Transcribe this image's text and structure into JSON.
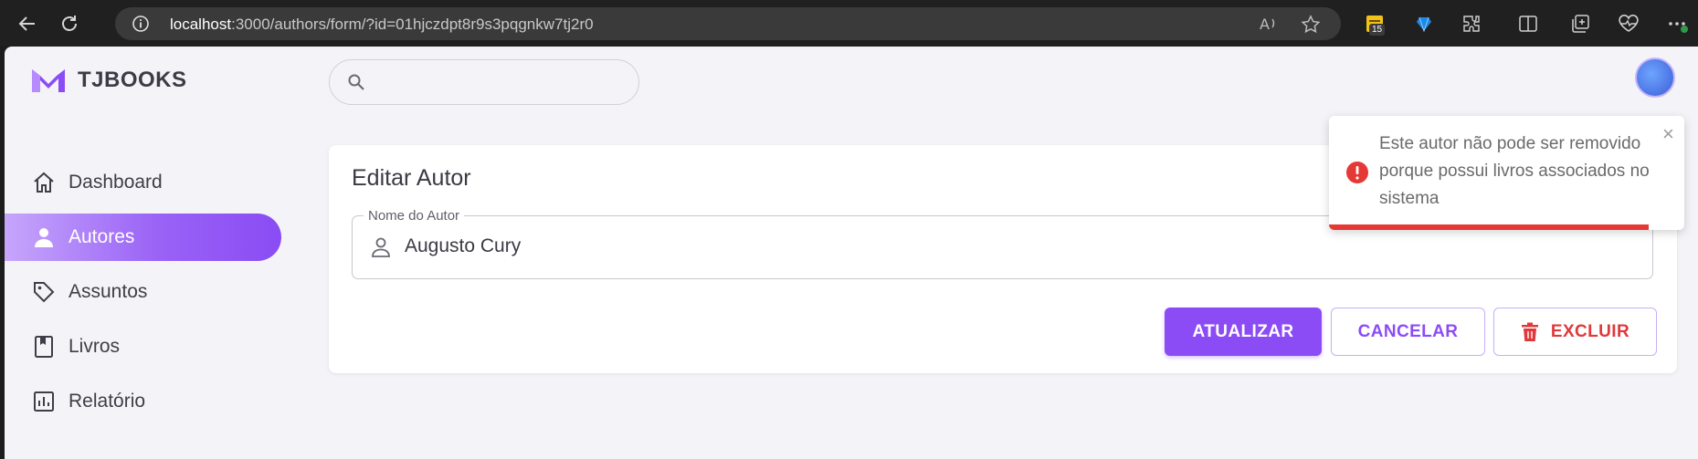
{
  "browser": {
    "url_host": "localhost",
    "url_rest": ":3000/authors/form/?id=01hjczdpt8r9s3pqgnkw7tj2r0",
    "extension_badge": "15"
  },
  "app": {
    "brand": "TJBOOKS"
  },
  "sidebar": {
    "items": [
      {
        "label": "Dashboard",
        "icon": "home-icon",
        "active": false
      },
      {
        "label": "Autores",
        "icon": "person-icon",
        "active": true
      },
      {
        "label": "Assuntos",
        "icon": "tag-icon",
        "active": false
      },
      {
        "label": "Livros",
        "icon": "book-icon",
        "active": false
      },
      {
        "label": "Relatório",
        "icon": "chart-icon",
        "active": false
      }
    ]
  },
  "search": {
    "placeholder": "",
    "value": ""
  },
  "form": {
    "title": "Editar Autor",
    "field_label": "Nome do Autor",
    "field_value": "Augusto Cury",
    "update_label": "ATUALIZAR",
    "cancel_label": "CANCELAR",
    "delete_label": "EXCLUIR"
  },
  "toast": {
    "message": "Este autor não pode ser removido porque possui livros associados no sistema",
    "close": "×",
    "progress_fraction": 0.9
  },
  "colors": {
    "accent": "#8c4cf5",
    "danger": "#e0393b",
    "toast_bar": "#e53935"
  }
}
